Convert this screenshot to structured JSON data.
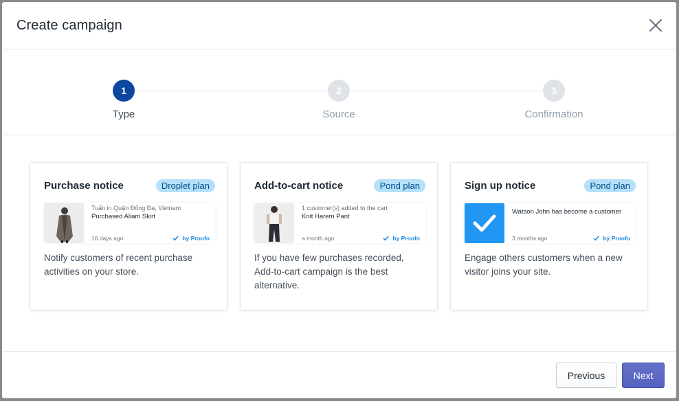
{
  "modal": {
    "title": "Create campaign"
  },
  "stepper": {
    "steps": [
      {
        "number": "1",
        "label": "Type",
        "active": true
      },
      {
        "number": "2",
        "label": "Source",
        "active": false
      },
      {
        "number": "3",
        "label": "Confirmation",
        "active": false
      }
    ]
  },
  "cards": [
    {
      "title": "Purchase notice",
      "plan": "Droplet plan",
      "preview": {
        "line1": "Tuấn in Quận Đống Đa, Vietnam",
        "line2": "Purchased Aliam Skirt",
        "time": "16 days ago",
        "by": "by Proofo"
      },
      "description": "Notify customers of recent purchase activities on your store."
    },
    {
      "title": "Add-to-cart notice",
      "plan": "Pond plan",
      "preview": {
        "line1": "1 customer(s) added to the cart",
        "line2": "Knit Harem Pant",
        "time": "a month ago",
        "by": "by Proofo"
      },
      "description": "If you have few purchases recorded, Add-to-cart campaign is the best alternative."
    },
    {
      "title": "Sign up notice",
      "plan": "Pond plan",
      "preview": {
        "line1": "Watson John has become a customer",
        "time": "3 months ago",
        "by": "by Proofo"
      },
      "description": "Engage others customers when a new visitor joins your site."
    }
  ],
  "footer": {
    "previous_label": "Previous",
    "next_label": "Next"
  },
  "colors": {
    "step_active": "#0d47a1",
    "step_inactive": "#dfe3e8",
    "badge_bg": "#b4e0fa",
    "primary_button": "#5c6ac4",
    "check_tile": "#2196f3",
    "proofo_blue": "#1e88e5"
  }
}
